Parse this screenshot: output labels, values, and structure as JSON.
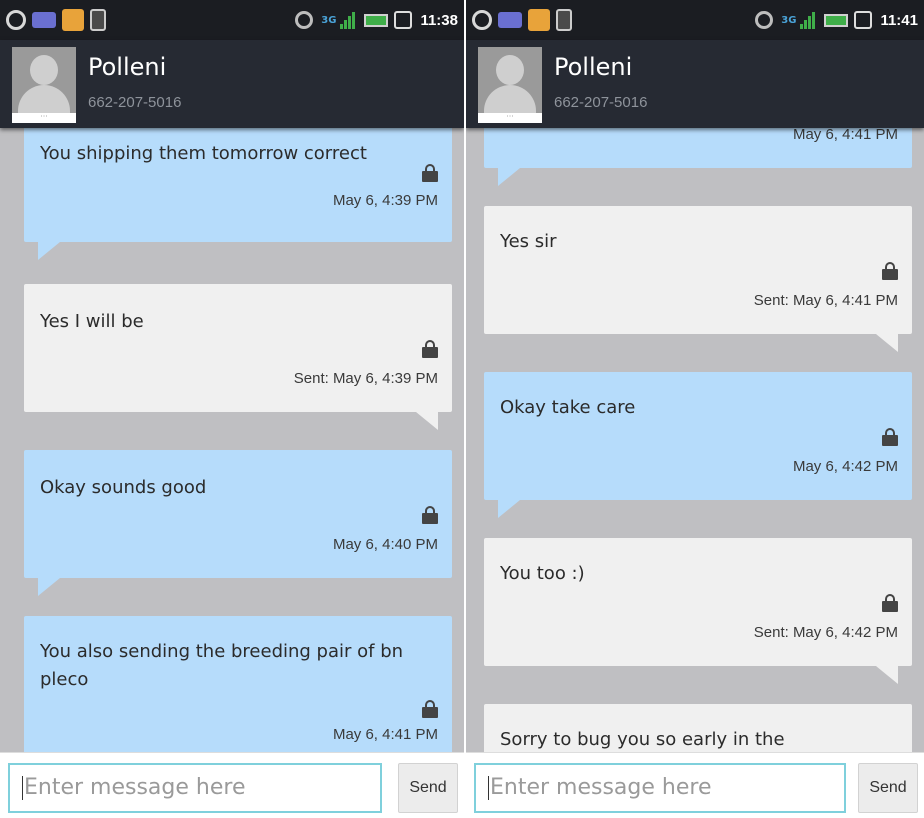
{
  "left": {
    "status": {
      "time": "11:38",
      "network": "3G"
    },
    "contact": {
      "name": "Polleni",
      "number": "662-207-5016"
    },
    "messages": [
      {
        "type": "in",
        "text": "You shipping them tomorrow correct",
        "time": "May 6, 4:39 PM"
      },
      {
        "type": "out",
        "text": "Yes I will be",
        "time": "Sent: May 6, 4:39 PM"
      },
      {
        "type": "in",
        "text": "Okay sounds good",
        "time": "May 6, 4:40 PM"
      },
      {
        "type": "in",
        "text": "You also sending the breeding pair of bn pleco",
        "time": "May 6, 4:41 PM"
      }
    ],
    "composer": {
      "placeholder": "Enter message here",
      "send_label": "Send"
    }
  },
  "right": {
    "status": {
      "time": "11:41",
      "network": "3G"
    },
    "contact": {
      "name": "Polleni",
      "number": "662-207-5016"
    },
    "messages": [
      {
        "type": "in",
        "text": "",
        "time": "May 6, 4:41 PM"
      },
      {
        "type": "out",
        "text": "Yes sir",
        "time": "Sent: May 6, 4:41 PM"
      },
      {
        "type": "in",
        "text": "Okay take care",
        "time": "May 6, 4:42 PM"
      },
      {
        "type": "out",
        "text": "You too :)",
        "time": "Sent: May 6, 4:42 PM"
      },
      {
        "type": "out",
        "text": "Sorry to bug you so early in the",
        "time": ""
      }
    ],
    "composer": {
      "placeholder": "Enter message here",
      "send_label": "Send"
    }
  },
  "colors": {
    "incoming": "#b6dcfb",
    "outgoing": "#f0f0f0",
    "background": "#bfbfc2",
    "header": "#262a33",
    "input_border": "#7fd0dc"
  },
  "icons": [
    "sync-icon",
    "mail-icon",
    "app-notification-icon",
    "usb-icon",
    "signal-icon",
    "battery-icon",
    "alarm-icon",
    "lock-icon",
    "contact-avatar-icon"
  ]
}
